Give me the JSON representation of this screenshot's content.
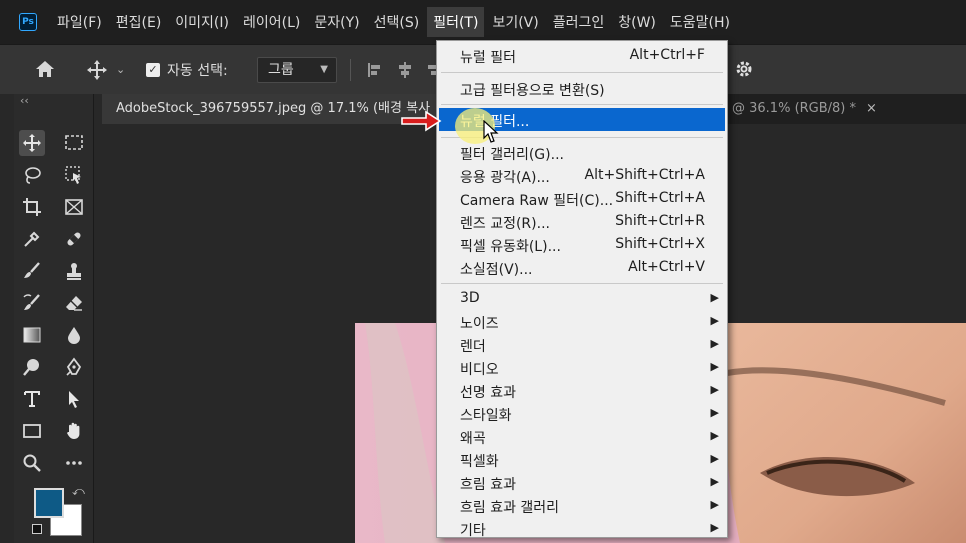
{
  "menubar": {
    "app_icon": "Ps",
    "items": [
      {
        "label": "파일(F)"
      },
      {
        "label": "편집(E)"
      },
      {
        "label": "이미지(I)"
      },
      {
        "label": "레이어(L)"
      },
      {
        "label": "문자(Y)"
      },
      {
        "label": "선택(S)"
      },
      {
        "label": "필터(T)",
        "active": true
      },
      {
        "label": "보기(V)"
      },
      {
        "label": "플러그인"
      },
      {
        "label": "창(W)"
      },
      {
        "label": "도움말(H)"
      }
    ]
  },
  "options_bar": {
    "auto_select_label": "자동 선택:",
    "auto_select_checked": true,
    "select_value": "그룹"
  },
  "document_tabs": {
    "active_tab": "AdobeStock_396759557.jpeg @ 17.1% (배경 복사",
    "second_tab": "@ 36.1% (RGB/8) *",
    "close_glyph": "×"
  },
  "toolbar": {
    "collapse_glyph": "‹‹",
    "foreground_color": "#0e5a86",
    "background_color": "#ffffff"
  },
  "filter_menu": {
    "items": [
      {
        "label": "뉴럴 필터",
        "shortcut": "Alt+Ctrl+F"
      },
      {
        "label": "고급 필터용으로 변환(S)",
        "shortcut": ""
      },
      {
        "label": "뉴럴 필터...",
        "shortcut": "",
        "highlighted": true
      },
      {
        "label": "필터 갤러리(G)...",
        "shortcut": ""
      },
      {
        "label": "응용 광각(A)...",
        "shortcut": "Alt+Shift+Ctrl+A"
      },
      {
        "label": "Camera Raw 필터(C)...",
        "shortcut": "Shift+Ctrl+A"
      },
      {
        "label": "렌즈 교정(R)...",
        "shortcut": "Shift+Ctrl+R"
      },
      {
        "label": "픽셀 유동화(L)...",
        "shortcut": "Shift+Ctrl+X"
      },
      {
        "label": "소실점(V)...",
        "shortcut": "Alt+Ctrl+V"
      },
      {
        "label": "3D",
        "submenu": true
      },
      {
        "label": "노이즈",
        "submenu": true
      },
      {
        "label": "렌더",
        "submenu": true
      },
      {
        "label": "비디오",
        "submenu": true
      },
      {
        "label": "선명 효과",
        "submenu": true
      },
      {
        "label": "스타일화",
        "submenu": true
      },
      {
        "label": "왜곡",
        "submenu": true
      },
      {
        "label": "픽셀화",
        "submenu": true
      },
      {
        "label": "흐림 효과",
        "submenu": true
      },
      {
        "label": "흐림 효과 갤러리",
        "submenu": true
      },
      {
        "label": "기타",
        "submenu": true
      }
    ],
    "submenu_glyph": "▶",
    "highlight_color": "#0a67cf"
  }
}
